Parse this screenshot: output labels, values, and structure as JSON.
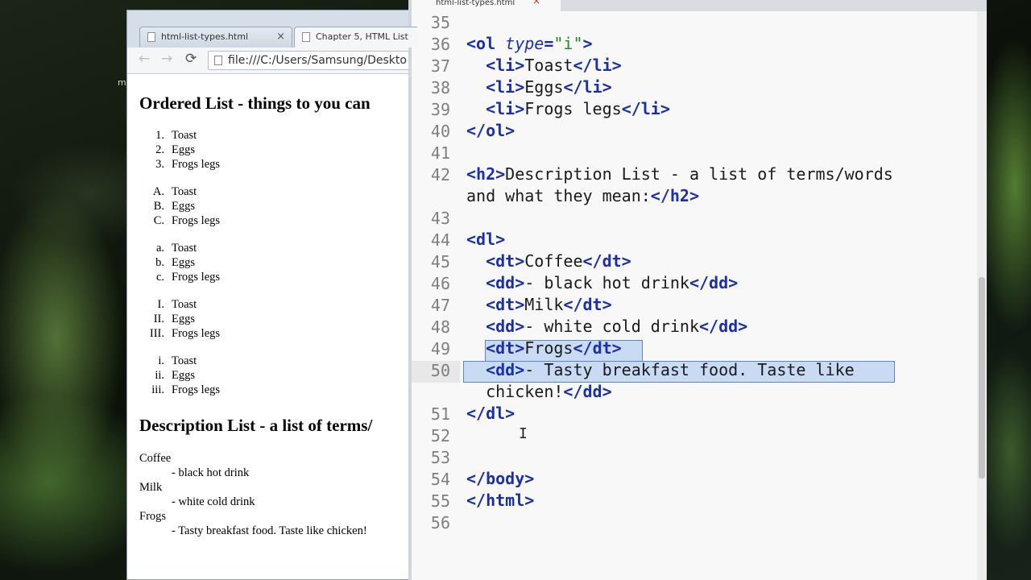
{
  "desktop": {
    "stray_letter": "m"
  },
  "browser": {
    "tabs": [
      {
        "title": "html-list-types.html",
        "close": "×"
      },
      {
        "title": "Chapter 5, HTML List"
      }
    ],
    "nav": {
      "back": "←",
      "forward": "→",
      "reload": "⟳"
    },
    "address": "file:///C:/Users/Samsung/Deskto",
    "page": {
      "heading_ordered": "Ordered List - things to you can",
      "lists": [
        {
          "items": [
            {
              "marker": "1.",
              "text": "Toast"
            },
            {
              "marker": "2.",
              "text": "Eggs"
            },
            {
              "marker": "3.",
              "text": "Frogs legs"
            }
          ]
        },
        {
          "items": [
            {
              "marker": "A.",
              "text": "Toast"
            },
            {
              "marker": "B.",
              "text": "Eggs"
            },
            {
              "marker": "C.",
              "text": "Frogs legs"
            }
          ]
        },
        {
          "items": [
            {
              "marker": "a.",
              "text": "Toast"
            },
            {
              "marker": "b.",
              "text": "Eggs"
            },
            {
              "marker": "c.",
              "text": "Frogs legs"
            }
          ]
        },
        {
          "items": [
            {
              "marker": "I.",
              "text": "Toast"
            },
            {
              "marker": "II.",
              "text": "Eggs"
            },
            {
              "marker": "III.",
              "text": "Frogs legs"
            }
          ]
        },
        {
          "items": [
            {
              "marker": "i.",
              "text": "Toast"
            },
            {
              "marker": "ii.",
              "text": "Eggs"
            },
            {
              "marker": "iii.",
              "text": "Frogs legs"
            }
          ]
        }
      ],
      "heading_description": "Description List - a list of terms/",
      "description": [
        {
          "term": "Coffee",
          "def": "- black hot drink"
        },
        {
          "term": "Milk",
          "def": "- white cold drink"
        },
        {
          "term": "Frogs",
          "def": "- Tasty breakfast food. Taste like chicken!"
        }
      ]
    }
  },
  "editor": {
    "tab": {
      "title": "html-list-types.html",
      "close": "×"
    },
    "line_numbers": [
      "35",
      "36",
      "37",
      "38",
      "39",
      "40",
      "41",
      "42",
      "",
      "43",
      "44",
      "45",
      "46",
      "47",
      "48",
      "49",
      "50",
      "",
      "51",
      "52",
      "53",
      "54",
      "55",
      "56"
    ],
    "lines": [
      [],
      [
        {
          "c": "tag",
          "t": "<ol "
        },
        {
          "c": "attr",
          "t": "type"
        },
        {
          "c": "tag",
          "t": "="
        },
        {
          "c": "str",
          "t": "\"i\""
        },
        {
          "c": "tag",
          "t": ">"
        }
      ],
      [
        {
          "c": "",
          "t": "  "
        },
        {
          "c": "tag",
          "t": "<li>"
        },
        {
          "c": "",
          "t": "Toast"
        },
        {
          "c": "tag",
          "t": "</li>"
        }
      ],
      [
        {
          "c": "",
          "t": "  "
        },
        {
          "c": "tag",
          "t": "<li>"
        },
        {
          "c": "",
          "t": "Eggs"
        },
        {
          "c": "tag",
          "t": "</li>"
        }
      ],
      [
        {
          "c": "",
          "t": "  "
        },
        {
          "c": "tag",
          "t": "<li>"
        },
        {
          "c": "",
          "t": "Frogs legs"
        },
        {
          "c": "tag",
          "t": "</li>"
        }
      ],
      [
        {
          "c": "tag",
          "t": "</ol>"
        }
      ],
      [],
      [
        {
          "c": "tag",
          "t": "<h2>"
        },
        {
          "c": "",
          "t": "Description List - a list of terms/words"
        }
      ],
      [
        {
          "c": "",
          "t": "and what they mean:"
        },
        {
          "c": "tag",
          "t": "</h2>"
        }
      ],
      [],
      [
        {
          "c": "tag",
          "t": "<dl>"
        }
      ],
      [
        {
          "c": "",
          "t": "  "
        },
        {
          "c": "tag",
          "t": "<dt>"
        },
        {
          "c": "",
          "t": "Coffee"
        },
        {
          "c": "tag",
          "t": "</dt>"
        }
      ],
      [
        {
          "c": "",
          "t": "  "
        },
        {
          "c": "tag",
          "t": "<dd>"
        },
        {
          "c": "",
          "t": "- black hot drink"
        },
        {
          "c": "tag",
          "t": "</dd>"
        }
      ],
      [
        {
          "c": "",
          "t": "  "
        },
        {
          "c": "tag",
          "t": "<dt>"
        },
        {
          "c": "",
          "t": "Milk"
        },
        {
          "c": "tag",
          "t": "</dt>"
        }
      ],
      [
        {
          "c": "",
          "t": "  "
        },
        {
          "c": "tag",
          "t": "<dd>"
        },
        {
          "c": "",
          "t": "- white cold drink"
        },
        {
          "c": "tag",
          "t": "</dd>"
        }
      ],
      [
        {
          "c": "",
          "t": "  "
        },
        {
          "c": "tag",
          "t": "<dt>"
        },
        {
          "c": "",
          "t": "Frogs"
        },
        {
          "c": "tag",
          "t": "</dt>"
        }
      ],
      [
        {
          "c": "",
          "t": "  "
        },
        {
          "c": "tag",
          "t": "<dd>"
        },
        {
          "c": "",
          "t": "- Tasty breakfast food. Taste like "
        }
      ],
      [
        {
          "c": "",
          "t": "  chicken!"
        },
        {
          "c": "tag",
          "t": "</dd>"
        }
      ],
      [
        {
          "c": "tag",
          "t": "</dl>"
        }
      ],
      [],
      [],
      [
        {
          "c": "tag",
          "t": "</body>"
        }
      ],
      [
        {
          "c": "tag",
          "t": "</html>"
        }
      ],
      []
    ]
  }
}
